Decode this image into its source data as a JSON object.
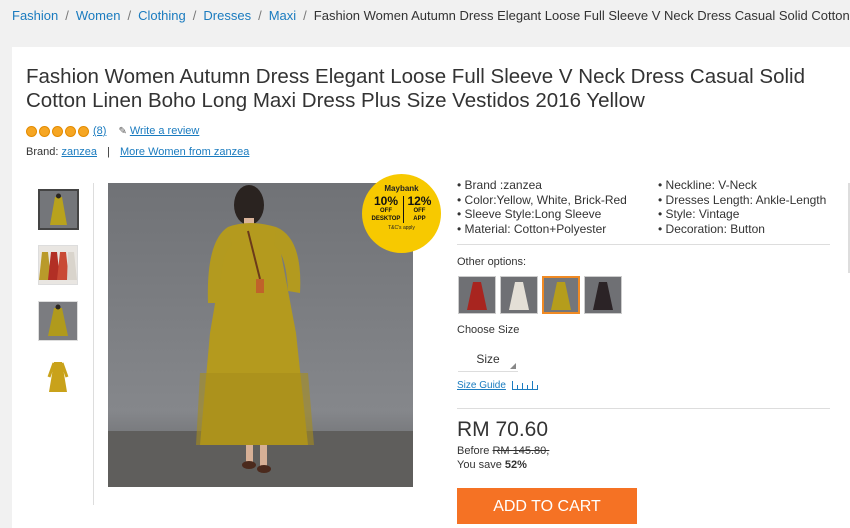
{
  "breadcrumb": {
    "items": [
      "Fashion",
      "Women",
      "Clothing",
      "Dresses",
      "Maxi"
    ],
    "current": "Fashion Women Autumn Dress Elegant Loose Full Sleeve V Neck Dress Casual Solid Cotton Linen Boho Lo"
  },
  "product": {
    "title": "Fashion Women Autumn Dress Elegant Loose Full Sleeve V Neck Dress Casual Solid\nCotton Linen Boho Long Maxi Dress Plus Size Vestidos 2016 Yellow",
    "rating_count": "(8)",
    "write_review": "Write a review",
    "brand_label": "Brand:",
    "brand_name": "zanzea",
    "more_from": "More Women from zanzea"
  },
  "promo": {
    "bank": "Maybank",
    "offer1_pct": "10%",
    "offer1_word": "OFF",
    "offer1_sub": "DESKTOP",
    "offer2_pct": "12%",
    "offer2_word": "OFF",
    "offer2_sub": "APP",
    "terms": "T&C's apply"
  },
  "specs": {
    "left": [
      "Brand :zanzea",
      "Color:Yellow, White, Brick-Red",
      "Sleeve Style:Long Sleeve",
      "Material: Cotton+Polyester"
    ],
    "right": [
      "Neckline: V-Neck",
      "Dresses Length: Ankle-Length",
      "Style: Vintage",
      "Decoration: Button"
    ]
  },
  "options": {
    "label": "Other options:",
    "swatches": [
      "red",
      "white",
      "yellow",
      "black"
    ]
  },
  "size": {
    "label": "Choose Size",
    "select": "Size",
    "guide": "Size Guide"
  },
  "pricing": {
    "price": "RM 70.60",
    "before_label": "Before",
    "before_price": "RM 145.80,",
    "save_label": "You save",
    "save_pct": "52%"
  },
  "cart": {
    "label": "ADD TO CART"
  },
  "colors": {
    "link": "#1a7bbf",
    "cta": "#f57224",
    "star": "#f6a623",
    "selected": "#f08a24",
    "badge": "#f7c900"
  }
}
